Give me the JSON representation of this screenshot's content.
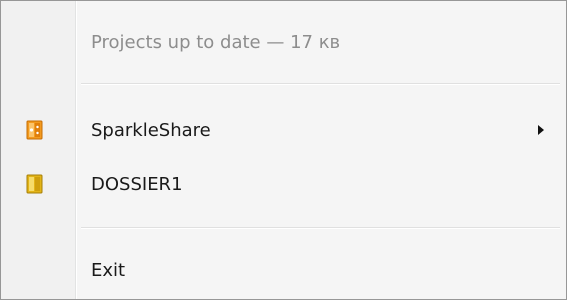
{
  "menu": {
    "status_label": "Projects up to date — 17 кв",
    "items": [
      {
        "label": "SparkleShare",
        "icon": "sparkleshare-folder-icon",
        "has_submenu": true
      },
      {
        "label": "DOSSIER1",
        "icon": "folder-icon",
        "has_submenu": false
      }
    ],
    "exit_label": "Exit"
  },
  "colors": {
    "menu_background": "#f5f5f5",
    "gutter_background": "#f1f1f1",
    "border": "#979797",
    "disabled_text": "#8d8d8d",
    "text": "#1a1a1a",
    "sparkleshare_icon": "#f39a1e",
    "folder_icon": "#e3b417"
  }
}
